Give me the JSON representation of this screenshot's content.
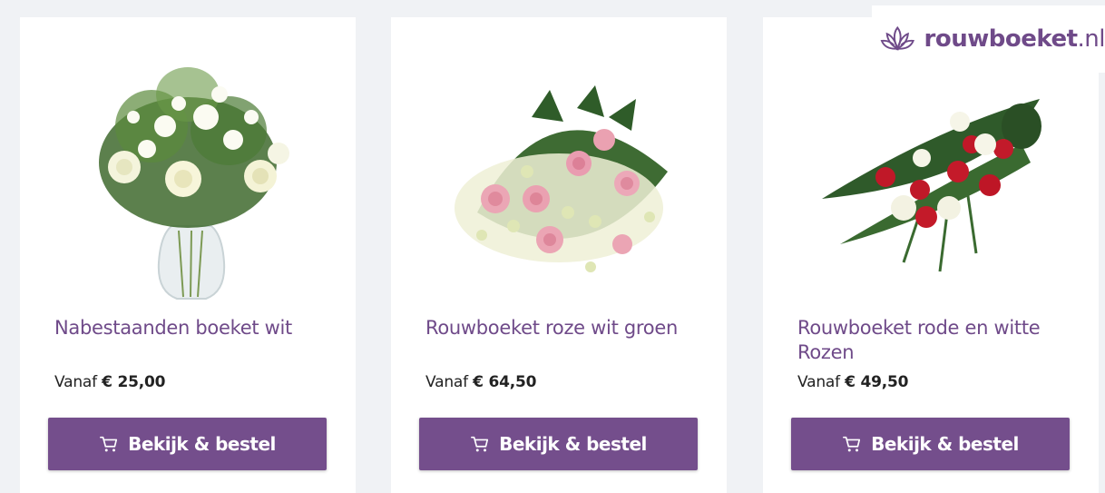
{
  "brand": {
    "name_bold": "rouwboeket",
    "name_suffix": ".nl",
    "color": "#6f4a89"
  },
  "accent": {
    "button_bg": "#744e8c",
    "title_color": "#6f4a89"
  },
  "products": [
    {
      "title": "Nabestaanden boeket wit",
      "price_prefix": "Vanaf",
      "price": "€ 25,00",
      "button_label": "Bekijk & bestel",
      "button_icon": "cart-icon",
      "image": "white-rose-bouquet-in-vase"
    },
    {
      "title": "Rouwboeket roze wit groen",
      "price_prefix": "Vanaf",
      "price": "€ 64,50",
      "button_label": "Bekijk & bestel",
      "button_icon": "cart-icon",
      "image": "pink-white-green-funeral-spray"
    },
    {
      "title": "Rouwboeket rode en witte Rozen",
      "price_prefix": "Vanaf",
      "price": "€ 49,50",
      "button_label": "Bekijk & bestel",
      "button_icon": "cart-icon",
      "image": "red-white-rose-funeral-spray"
    }
  ]
}
